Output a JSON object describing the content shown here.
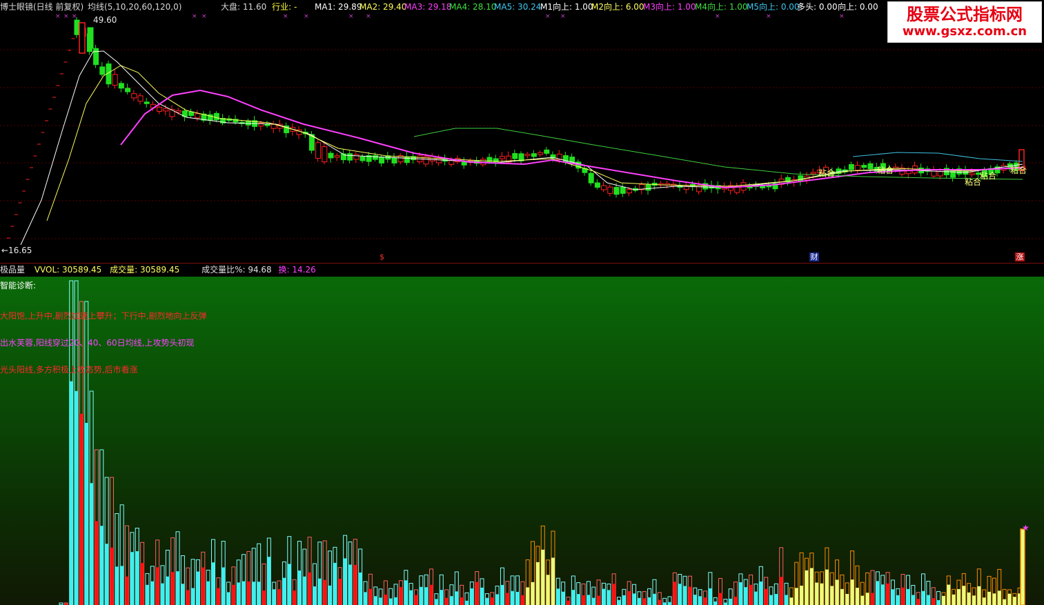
{
  "upper_header": {
    "title": "博士眼镜(日线 前复权)",
    "ma_label": "均线(5,10,20,60,120,0)",
    "market_label": "大盘:",
    "market_value": "11.60",
    "industry_label": "行业:",
    "industry_value": "-",
    "ma1": "MA1: 29.89",
    "ma2": "MA2: 29.40",
    "ma3": "MA3: 29.18",
    "ma4": "MA4: 28.10",
    "ma5": "MA5: 30.24",
    "m1": "M1向上: 1.00",
    "m2": "M2向上: 6.00",
    "m3": "M3向上: 1.00",
    "m4": "M4向上: 1.00",
    "m5": "M5向上: 0.00",
    "duotou": "多头: 0.00",
    "xiangshang": "向上: 0.00"
  },
  "price_labels": {
    "high": "49.60",
    "low": "←16.65"
  },
  "zhan_labels": [
    "粘合",
    "粘合",
    "粘合",
    "粘合",
    "粘合"
  ],
  "event_markers": [
    "$",
    "财",
    "涨"
  ],
  "lower_header": {
    "name": "极品量",
    "vvol": "VVOL: 30589.45",
    "volume": "成交量: 30589.45",
    "ratio": "成交量比%: 94.68",
    "turnover": "换: 14.26"
  },
  "diagnosis": {
    "title": "智能诊断:",
    "lines": [
      "大阳饱,上升中,剧烈加速上攀升；下行中,剧烈地向上反弹",
      "出水芙蓉,阳线穿过20、40、60日均线,上攻势头初现",
      "光头阳线,多方积极上攻态势,后市看涨"
    ]
  },
  "watermark": {
    "title": "股票公式指标网",
    "url": "www.gsxz.com.cn"
  },
  "colors": {
    "up": "#ff2020",
    "down": "#20e020",
    "ma1": "#ffffff",
    "ma2": "#ffff60",
    "ma3": "#ff40ff",
    "ma4": "#40d040",
    "ma5": "#40c0e0",
    "vol_cyan": "#3cf0f0",
    "vol_red": "#ff1010",
    "vol_yellow": "#e8ff80",
    "vol_orange": "#ff8a00"
  }
}
